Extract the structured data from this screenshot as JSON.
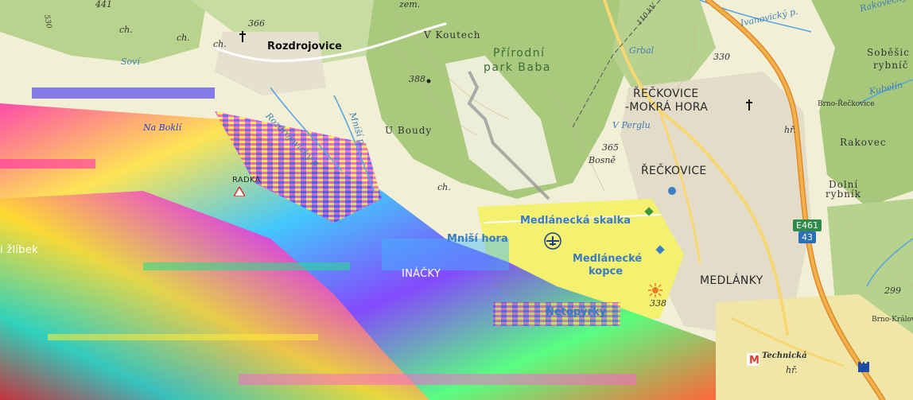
{
  "places": {
    "rozdrojovice": "Rozdrojovice",
    "v_koutech": "V Koutech",
    "prirodni_park_l1": "Přírodní",
    "prirodni_park_l2": "park Baba",
    "reckovice_mokra_l1": "ŘEČKOVICE",
    "reckovice_mokra_l2": "-MOKRÁ HORA",
    "reckovice": "ŘEČKOVICE",
    "sobesice_l1": "Soběšic",
    "sobesice_l2": "rybníč",
    "rakovec": "Rakovec",
    "dolni_rybnik_l1": "Dolní",
    "dolni_rybnik_l2": "rybník",
    "u_boudy": "U Boudy",
    "medlanky": "MEDLÁNKY",
    "na_bokli": "Na Boklí",
    "zlibek": "i žlíbek",
    "jinacky": "INÁČKY",
    "bosne": "Bosně",
    "v_perglu": "V Perglu",
    "grbal": "Grbal",
    "brno_reckovice": "Brno-Řečkovice",
    "brno_kralovo": "Brno-Králov",
    "technicka": "Technická",
    "bradka": "RADKA",
    "sovi": "Soví",
    "zem": "zem."
  },
  "pois": {
    "medlanecka_skalka": "Medlánecká skalka",
    "medlanecke_kopce_l1": "Medlánecké",
    "medlanecke_kopce_l2": "kopce",
    "mnisi_hora": "Mniší hora",
    "netopyrky": "Netopýrky"
  },
  "water": {
    "rozdrojovicky_p": "Rozdrojovický p.",
    "mnisi_p": "Mniší p.",
    "ivanovicky_p": "Ivanovický p.",
    "kubelin": "Kubelín",
    "rakovecky": "Rakovecký"
  },
  "elevations": [
    "441",
    "366",
    "388",
    "330",
    "365",
    "338",
    "299"
  ],
  "misc": {
    "ch1": "ch.",
    "ch2": "ch.",
    "ch3": "ch.",
    "ch4": "ch.",
    "hr1": "hř.",
    "hr2": "hř.",
    "kv110": "110 kV",
    "num530": "530"
  },
  "road_shields": {
    "e461": "E461",
    "r43": "43"
  },
  "colors": {
    "forest": "#b7d18f",
    "forest_dark": "#9cc171",
    "meadow": "#eef0c8",
    "urban": "#e4ddc9",
    "highway": "#f0a640",
    "road": "#f7d773",
    "water": "#5aa6e0",
    "shield_green": "#2f8a4a",
    "shield_blue": "#2a6fb7"
  }
}
